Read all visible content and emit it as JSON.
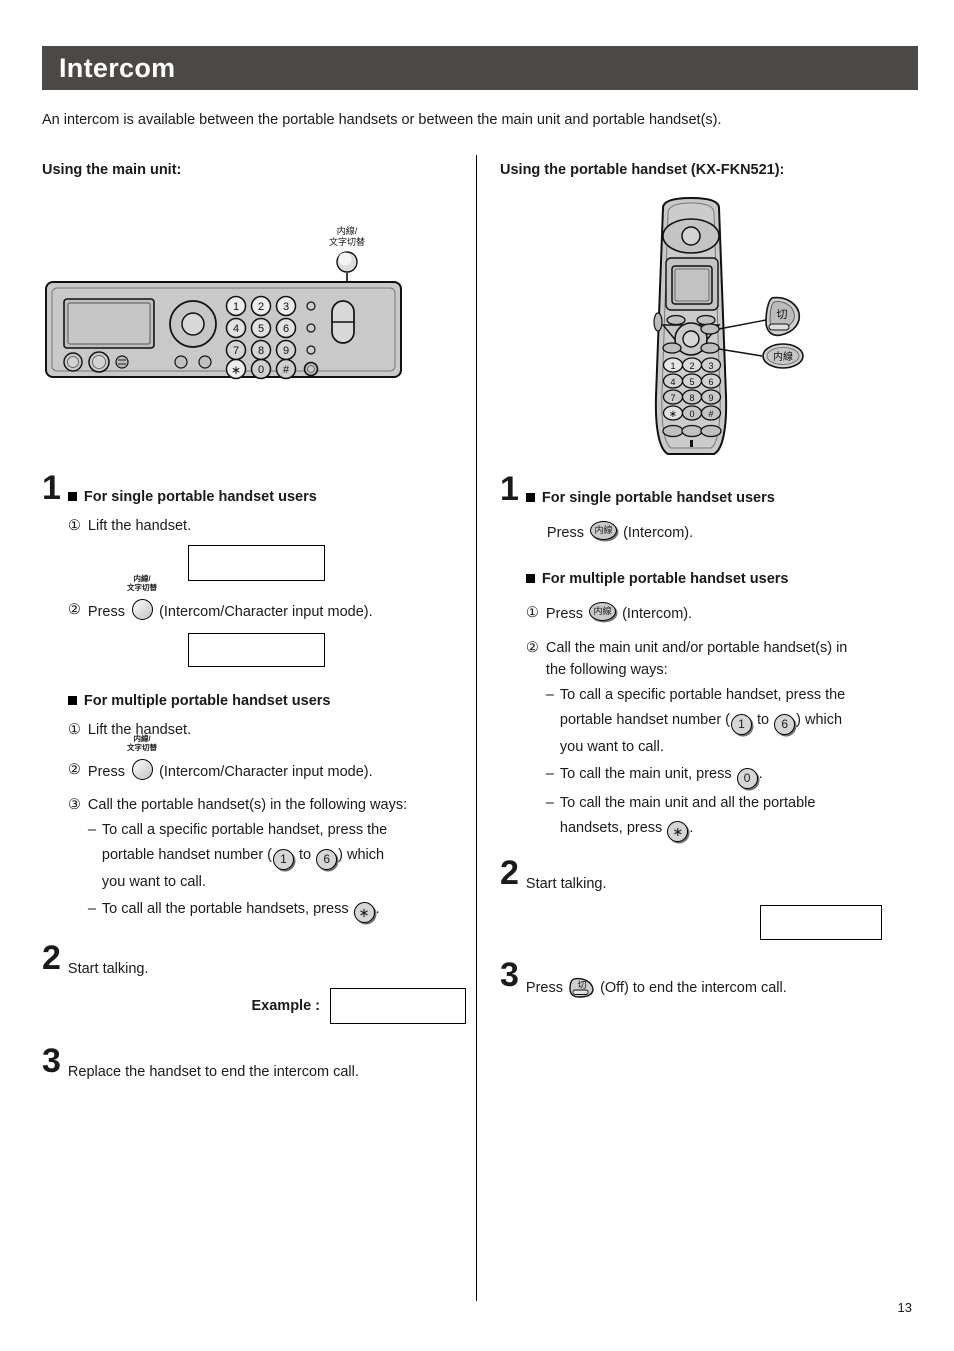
{
  "document": {
    "title": "Intercom",
    "intro": "An intercom is available between the portable handsets or between the main unit and portable handset(s).",
    "page_number": "13",
    "header_bg_color": "#4b4846"
  },
  "columns": {
    "left": {
      "heading": "Using the main unit:",
      "figure": {
        "name": "main-unit-front-panel",
        "callout_label_line1": "内線/",
        "callout_label_line2": "文字切替",
        "keypad": [
          "1",
          "2",
          "3",
          "4",
          "5",
          "6",
          "7",
          "8",
          "9",
          "∗",
          "0",
          "#"
        ]
      },
      "steps": [
        {
          "number": "1",
          "sections": [
            {
              "subhead": "For single portable handset users",
              "items": [
                {
                  "marker": "①",
                  "text": "Lift the handset."
                },
                {
                  "marker": "②",
                  "text_before": "Press",
                  "button": "round-intercom-button",
                  "button_caption_1": "内線/",
                  "button_caption_2": "文字切替",
                  "text_after": "(Intercom/Character input mode)."
                }
              ]
            },
            {
              "subhead": "For multiple portable handset users",
              "items": [
                {
                  "marker": "①",
                  "text": "Lift the handset."
                },
                {
                  "marker": "②",
                  "text_before": "Press",
                  "button": "round-intercom-button",
                  "button_caption_1": "内線/",
                  "button_caption_2": "文字切替",
                  "text_after": "(Intercom/Character input mode)."
                },
                {
                  "marker": "③",
                  "text": "Call the portable handset(s) in the following ways:"
                }
              ],
              "dashes": [
                {
                  "line1": "To call a specific portable handset, press the",
                  "line2_a": "portable handset number (",
                  "key_a": "1",
                  "line2_b": " to ",
                  "key_b": "6",
                  "line2_c": ") which",
                  "line3": "you want to call."
                },
                {
                  "line1_a": "To call all the portable handsets, press ",
                  "key_a": "∗",
                  "line1_b": "."
                }
              ]
            }
          ]
        },
        {
          "number": "2",
          "text": "Start talking.",
          "example_label": "Example :"
        },
        {
          "number": "3",
          "text": "Replace the handset to end the intercom call."
        }
      ]
    },
    "right": {
      "heading": "Using the portable handset (KX-FKN521):",
      "figure": {
        "name": "portable-handset",
        "callout_off": "切",
        "callout_intercom": "内線",
        "keypad": [
          "1",
          "2",
          "3",
          "4",
          "5",
          "6",
          "7",
          "8",
          "9",
          "∗",
          "0",
          "#"
        ]
      },
      "steps": [
        {
          "number": "1",
          "sections": [
            {
              "subhead": "For single portable handset users",
              "plain": {
                "text_before": "Press",
                "key": "内線",
                "text_after": "(Intercom)."
              }
            },
            {
              "subhead": "For multiple portable handset users",
              "items": [
                {
                  "marker": "①",
                  "text_before": "Press",
                  "key": "内線",
                  "text_after": "(Intercom)."
                },
                {
                  "marker": "②",
                  "line1": "Call the main unit and/or portable handset(s) in",
                  "line2": "the following ways:"
                }
              ],
              "dashes": [
                {
                  "line1": "To call a specific portable handset, press the",
                  "line2_a": "portable handset number (",
                  "key_a": "1",
                  "line2_b": " to ",
                  "key_b": "6",
                  "line2_c": ") which",
                  "line3": "you want to call."
                },
                {
                  "line1_a": "To call the main unit, press ",
                  "key_a": "0",
                  "line1_b": "."
                },
                {
                  "line1": "To call the main unit and all the portable",
                  "line2_a": "handsets, press ",
                  "key_a": "∗",
                  "line2_b": "."
                }
              ]
            }
          ]
        },
        {
          "number": "2",
          "text": "Start talking."
        },
        {
          "number": "3",
          "text_before": "Press",
          "key": "切",
          "text_after": "(Off) to end the intercom call."
        }
      ]
    }
  }
}
